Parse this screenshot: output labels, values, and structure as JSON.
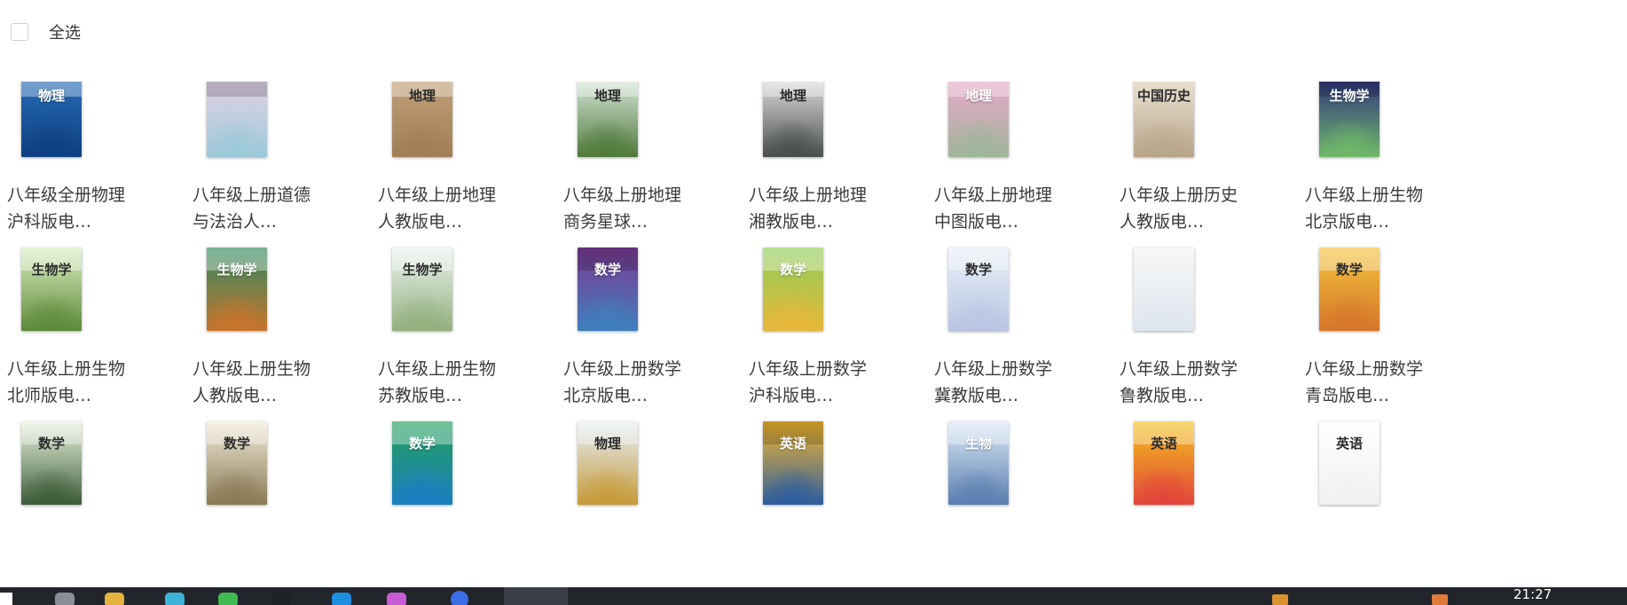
{
  "select_all": {
    "label": "全选",
    "checked": false
  },
  "books": [
    {
      "title": "八年级全册物理沪科版电…",
      "cover_title": "物理",
      "cover_colors": [
        "#2a6fb8",
        "#0d3f80"
      ],
      "title_dark": false,
      "band": "light"
    },
    {
      "title": "八年级上册道德与法治人…",
      "cover_title": "",
      "cover_colors": [
        "#e9d3e6",
        "#9cc9d9"
      ],
      "title_dark": true,
      "band": "dark"
    },
    {
      "title": "八年级上册地理人教版电…",
      "cover_title": "地理",
      "cover_colors": [
        "#c4a27a",
        "#a07e58"
      ],
      "title_dark": true,
      "band": "light"
    },
    {
      "title": "八年级上册地理商务星球…",
      "cover_title": "地理",
      "cover_colors": [
        "#dfeee3",
        "#507a3c"
      ],
      "title_dark": true,
      "band": "light"
    },
    {
      "title": "八年级上册地理湘教版电…",
      "cover_title": "地理",
      "cover_colors": [
        "#e8e8e8",
        "#4a4f4c"
      ],
      "title_dark": true,
      "band": "light"
    },
    {
      "title": "八年级上册地理中图版电…",
      "cover_title": "地理",
      "cover_colors": [
        "#f1a8cf",
        "#9fb59a"
      ],
      "title_dark": false,
      "band": "light"
    },
    {
      "title": "八年级上册历史人教版电…",
      "cover_title": "中国历史",
      "cover_colors": [
        "#efe6d8",
        "#b8a58a"
      ],
      "title_dark": true,
      "band": "none"
    },
    {
      "title": "八年级上册生物北京版电…",
      "cover_title": "生物学",
      "cover_colors": [
        "#2b2d7d",
        "#6fb86a"
      ],
      "title_dark": false,
      "band": "dark"
    },
    {
      "title": "八年级上册生物北师版电…",
      "cover_title": "生物学",
      "cover_colors": [
        "#d9efc0",
        "#5d8a3a"
      ],
      "title_dark": true,
      "band": "light"
    },
    {
      "title": "八年级上册生物人教版电…",
      "cover_title": "生物学",
      "cover_colors": [
        "#2f8a62",
        "#c8742c"
      ],
      "title_dark": false,
      "band": "light"
    },
    {
      "title": "八年级上册生物苏教版电…",
      "cover_title": "生物学",
      "cover_colors": [
        "#e9f3ee",
        "#93b07d"
      ],
      "title_dark": true,
      "band": "light"
    },
    {
      "title": "八年级上册数学北京版电…",
      "cover_title": "数学",
      "cover_colors": [
        "#7c3a93",
        "#3f7fbd"
      ],
      "title_dark": false,
      "band": "dark"
    },
    {
      "title": "八年级上册数学沪科版电…",
      "cover_title": "数学",
      "cover_colors": [
        "#8fce5a",
        "#e7b73a"
      ],
      "title_dark": false,
      "band": "light"
    },
    {
      "title": "八年级上册数学冀教版电…",
      "cover_title": "数学",
      "cover_colors": [
        "#e8f0f8",
        "#b9c6e3"
      ],
      "title_dark": true,
      "band": "light"
    },
    {
      "title": "八年级上册数学鲁教版电…",
      "cover_title": "",
      "cover_colors": [
        "#f7f7f7",
        "#dfe6ee"
      ],
      "title_dark": true,
      "band": "none"
    },
    {
      "title": "八年级上册数学青岛版电…",
      "cover_title": "数学",
      "cover_colors": [
        "#f2c33c",
        "#d6762a"
      ],
      "title_dark": true,
      "band": "light"
    },
    {
      "title": "",
      "cover_title": "数学",
      "cover_colors": [
        "#e9f3df",
        "#3d5d3a"
      ],
      "title_dark": true,
      "band": "light"
    },
    {
      "title": "",
      "cover_title": "数学",
      "cover_colors": [
        "#f1ead8",
        "#8a7b55"
      ],
      "title_dark": true,
      "band": "light"
    },
    {
      "title": "",
      "cover_title": "数学",
      "cover_colors": [
        "#23a05a",
        "#1a7fc2"
      ],
      "title_dark": false,
      "band": "light"
    },
    {
      "title": "",
      "cover_title": "物理",
      "cover_colors": [
        "#e5eef6",
        "#c79b3a"
      ],
      "title_dark": true,
      "band": "light"
    },
    {
      "title": "",
      "cover_title": "英语",
      "cover_colors": [
        "#f3b62d",
        "#2e5e9e"
      ],
      "title_dark": false,
      "band": "dark"
    },
    {
      "title": "",
      "cover_title": "生物",
      "cover_colors": [
        "#dbe9f7",
        "#5a7fb0"
      ],
      "title_dark": false,
      "band": "light"
    },
    {
      "title": "",
      "cover_title": "英语",
      "cover_colors": [
        "#f4c21e",
        "#e2453a"
      ],
      "title_dark": true,
      "band": "light"
    },
    {
      "title": "",
      "cover_title": "英语",
      "cover_colors": [
        "#ffffff",
        "#f1f1f1"
      ],
      "title_dark": true,
      "band": "none"
    }
  ],
  "taskbar": {
    "time": "21:27",
    "start_icon": "windows-start-icon",
    "app_icons": [
      {
        "name": "search-icon",
        "color": "#8a8f96"
      },
      {
        "name": "file-explorer-icon",
        "color": "#e6b13c"
      },
      {
        "name": "browser-icon",
        "color": "#3db3d9"
      },
      {
        "name": "chat-icon",
        "color": "#3fb950"
      },
      {
        "name": "media-icon",
        "color": "#1e2227"
      },
      {
        "name": "messenger-icon",
        "color": "#1d8fe0"
      },
      {
        "name": "app-icon",
        "color": "#c95bd6"
      },
      {
        "name": "active-browser-icon",
        "color": "#3c6ee8"
      }
    ],
    "tray_icons": [
      {
        "name": "tray-folder-icon",
        "color": "#d9922e"
      },
      {
        "name": "tray-app-icon",
        "color": "#e07a3a"
      }
    ]
  }
}
